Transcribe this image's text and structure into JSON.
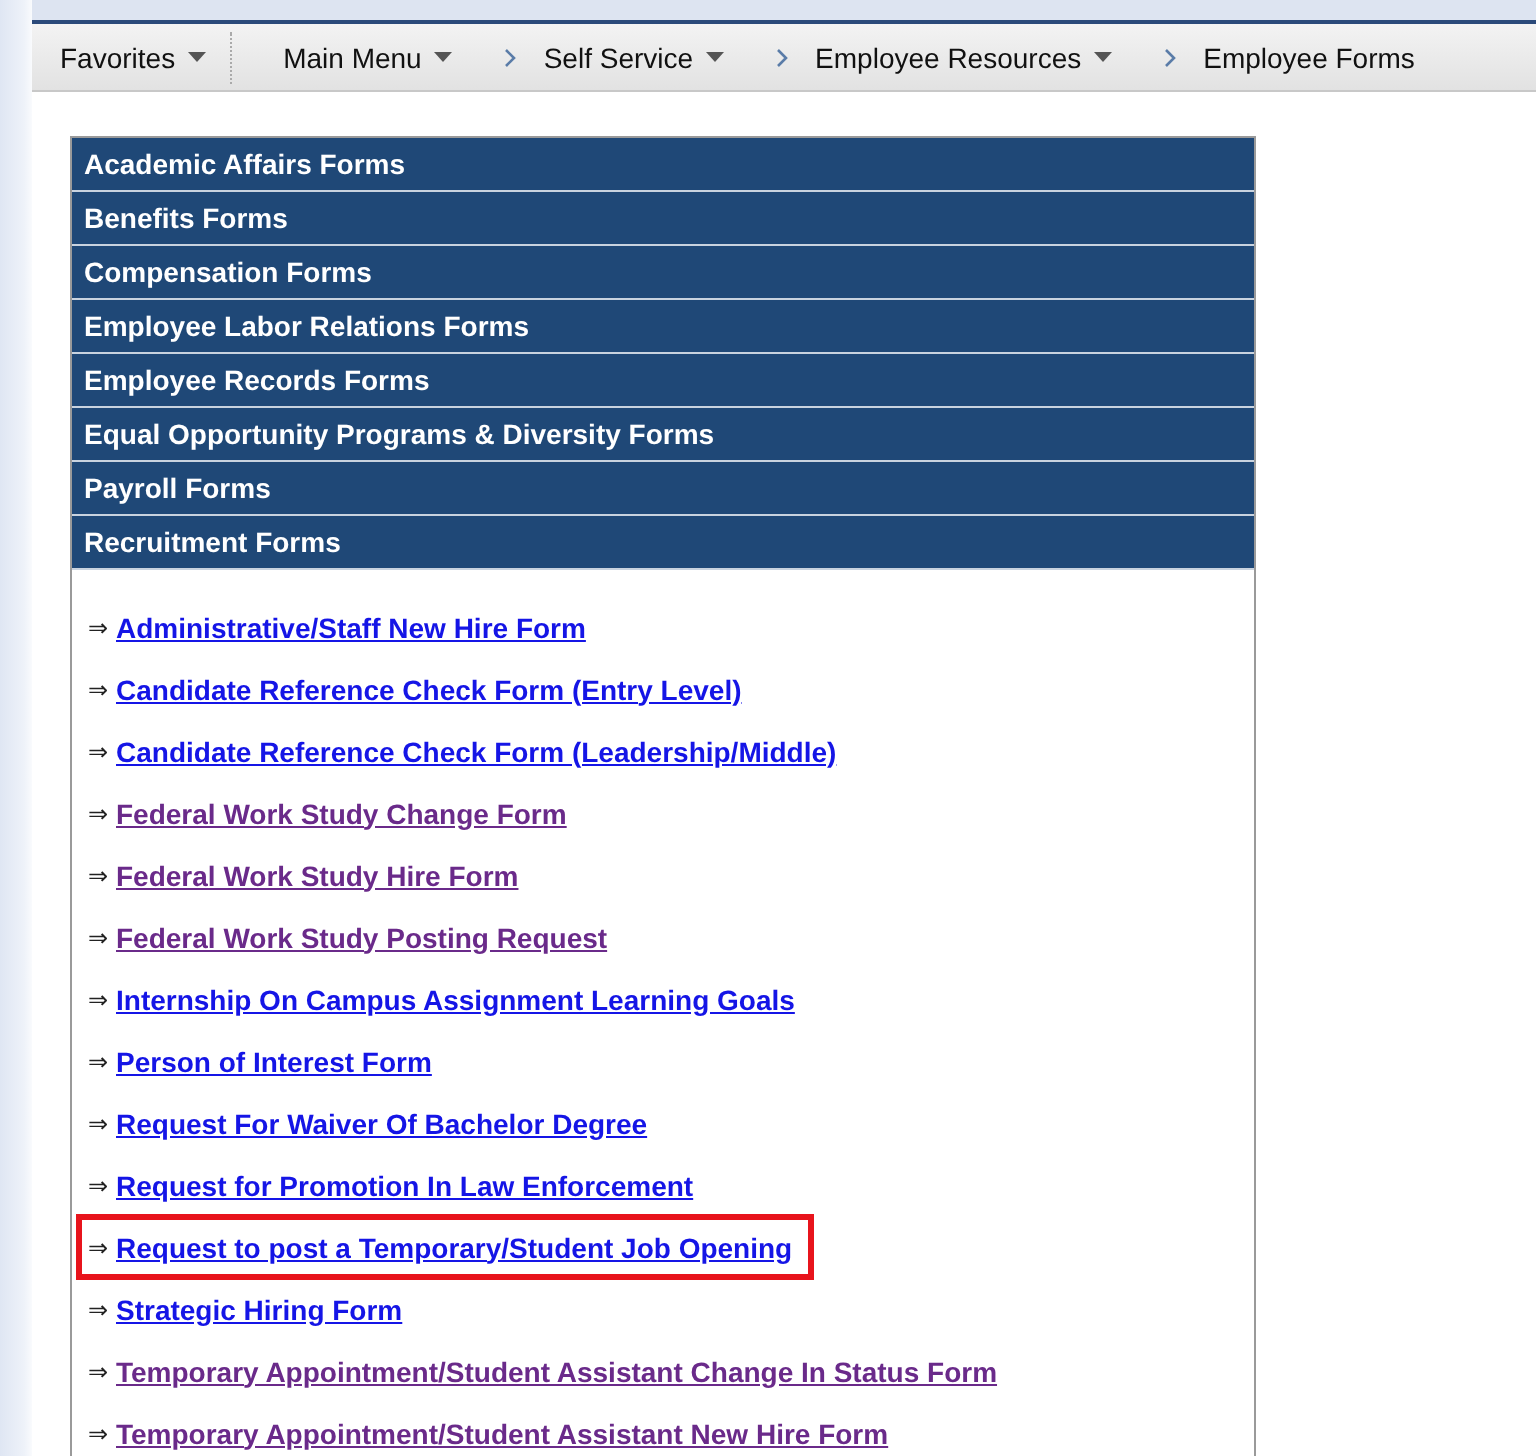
{
  "breadcrumb": [
    {
      "label": "Favorites",
      "has_menu": true,
      "separator_before": false
    },
    {
      "label": "Main Menu",
      "has_menu": true,
      "separator_before": false
    },
    {
      "label": "Self Service",
      "has_menu": true,
      "separator_before": true
    },
    {
      "label": "Employee Resources",
      "has_menu": true,
      "separator_before": true
    },
    {
      "label": "Employee Forms",
      "has_menu": false,
      "separator_before": true
    }
  ],
  "sections": [
    {
      "title": "Academic Affairs Forms"
    },
    {
      "title": "Benefits Forms"
    },
    {
      "title": "Compensation Forms"
    },
    {
      "title": "Employee Labor Relations Forms"
    },
    {
      "title": "Employee Records Forms"
    },
    {
      "title": "Equal Opportunity Programs & Diversity Forms"
    },
    {
      "title": "Payroll Forms"
    },
    {
      "title": "Recruitment Forms",
      "links": [
        {
          "bullet": "⇒",
          "label": "Administrative/Staff New Hire Form",
          "visited": false,
          "highlighted": false
        },
        {
          "bullet": "⇒",
          "label": "Candidate Reference Check Form (Entry Level)",
          "visited": false,
          "highlighted": false
        },
        {
          "bullet": "⇒",
          "label": "Candidate Reference Check Form (Leadership/Middle)",
          "visited": false,
          "highlighted": false
        },
        {
          "bullet": "⇒",
          "label": "Federal Work Study Change Form",
          "visited": true,
          "highlighted": false
        },
        {
          "bullet": "⇒",
          "label": "Federal Work Study Hire Form",
          "visited": true,
          "highlighted": false
        },
        {
          "bullet": "⇒",
          "label": "Federal Work Study Posting Request",
          "visited": true,
          "highlighted": false
        },
        {
          "bullet": "⇒",
          "label": "Internship On Campus Assignment Learning Goals",
          "visited": false,
          "highlighted": false
        },
        {
          "bullet": "⇒",
          "label": "Person of Interest Form",
          "visited": false,
          "highlighted": false
        },
        {
          "bullet": "⇒",
          "label": "Request For Waiver Of Bachelor Degree",
          "visited": false,
          "highlighted": false
        },
        {
          "bullet": "⇒",
          "label": "Request for Promotion In Law Enforcement",
          "visited": false,
          "highlighted": false
        },
        {
          "bullet": "⇒",
          "label": "Request to post a Temporary/Student Job Opening",
          "visited": false,
          "highlighted": true
        },
        {
          "bullet": "⇒",
          "label": "Strategic Hiring Form",
          "visited": false,
          "highlighted": false
        },
        {
          "bullet": "⇒",
          "label": "Temporary Appointment/Student Assistant Change In Status Form",
          "visited": true,
          "highlighted": false
        },
        {
          "bullet": "⇒",
          "label": "Temporary Appointment/Student Assistant New Hire Form",
          "visited": true,
          "highlighted": false
        }
      ]
    }
  ]
}
